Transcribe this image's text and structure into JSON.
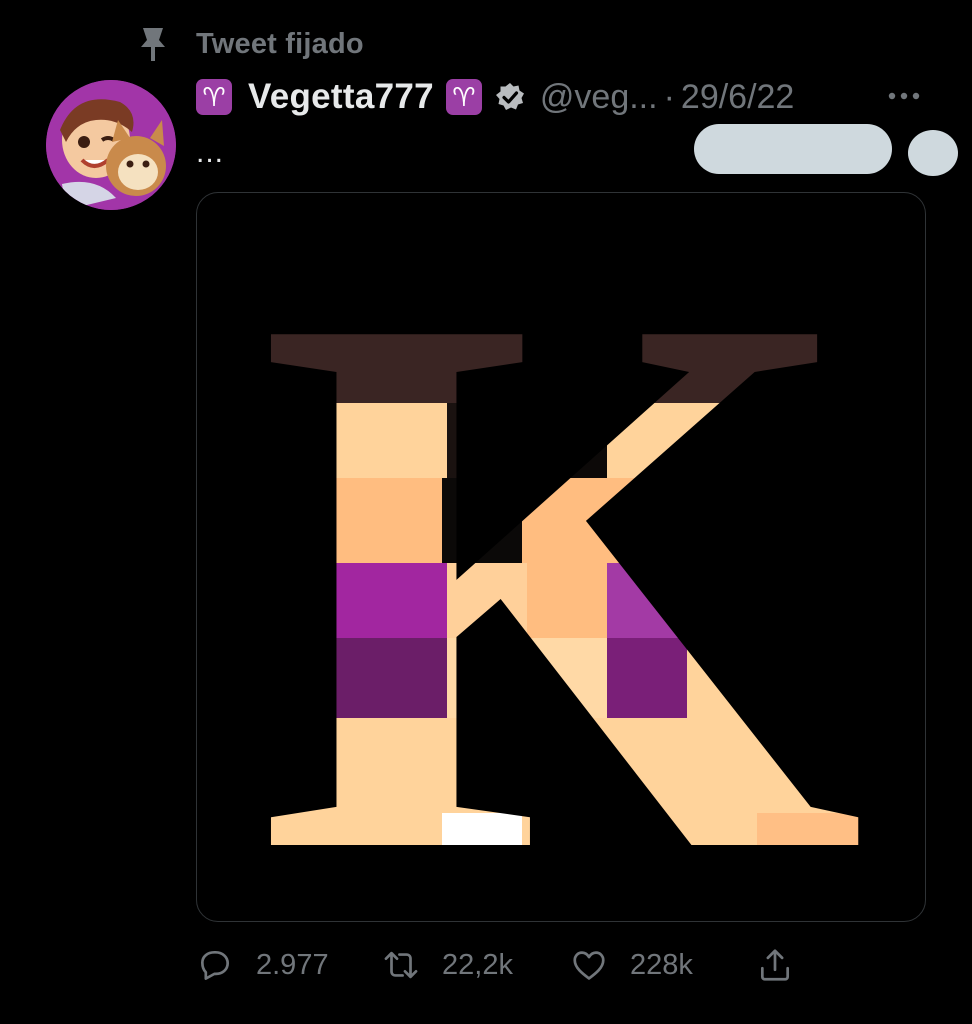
{
  "pinned": {
    "label": "Tweet fijado",
    "icon": "pin-icon"
  },
  "author": {
    "emoji_left": "♈",
    "name": "Vegetta777",
    "emoji_right": "♈",
    "verified_icon": "verified-badge-icon",
    "handle": "@veg...",
    "separator": "·",
    "date": "29/6/22",
    "avatar_color": "#a235a8"
  },
  "tweet": {
    "text": "...",
    "media_letter": "K"
  },
  "actions": {
    "reply": {
      "icon": "reply-icon",
      "count": "2.977"
    },
    "retweet": {
      "icon": "retweet-icon",
      "count": "22,2k"
    },
    "like": {
      "icon": "heart-icon",
      "count": "228k"
    },
    "share": {
      "icon": "share-icon"
    }
  },
  "colors": {
    "background": "#000000",
    "text": "#e7e9ea",
    "muted": "#71767b",
    "redaction": "#cfd9de"
  }
}
